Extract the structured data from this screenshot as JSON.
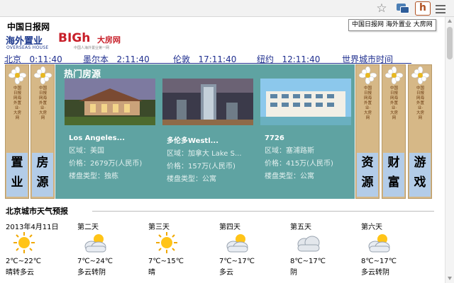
{
  "toolbar": {
    "star_icon": "star-icon",
    "ext_icon": "screens-extension-icon",
    "h_label": "h",
    "menu_icon": "menu-icon"
  },
  "tooltip": "中国日报网 海外置业 大房网",
  "logo": {
    "chinadaily": "中国日报网",
    "haiwai": "海外置业",
    "overseas_house": "OVERSEAS HOUSE",
    "bigh": "BIGh",
    "dafang": "大房网",
    "slogan": "中国人海外置业第一网"
  },
  "times": [
    {
      "city": "北京",
      "time": "0:11:40"
    },
    {
      "city": "墨尔本",
      "time": "2:11:40"
    },
    {
      "city": "伦敦",
      "time": "17:11:40"
    },
    {
      "city": "纽约",
      "time": "12:11:40"
    }
  ],
  "world_time_link": "世界城市时间",
  "banners": [
    {
      "vtext": "中国日报网海外置业·大房网",
      "big": "置业"
    },
    {
      "vtext": "中国日报网海外置业·大房网",
      "big": "房源"
    },
    {
      "vtext": "中国日报网海外置业·大房网",
      "big": "资源"
    },
    {
      "vtext": "中国日报网海外置业·大房网",
      "big": "财富"
    },
    {
      "vtext": "中国日报网海外置业·大房网",
      "big": "游戏"
    }
  ],
  "hot": {
    "title": "热门房源",
    "listings": [
      {
        "name": "Los Angeles...",
        "area": "区域：美国",
        "price": "价格：2679万(人民币)",
        "type": "楼盘类型：独栋"
      },
      {
        "name": "多伦多Westl...",
        "area": "区域：加拿大 Lake S...",
        "price": "价格：157万(人民币)",
        "type": "楼盘类型：公寓"
      },
      {
        "name": "7726",
        "area": "区域：塞浦路斯",
        "price": "价格：415万(人民币)",
        "type": "楼盘类型：公寓"
      }
    ]
  },
  "weather": {
    "title": "北京城市天气预报",
    "days": [
      {
        "label": "2013年4月11日",
        "icon": "sunny-icon",
        "temp": "2℃~22℃",
        "desc": "晴转多云"
      },
      {
        "label": "第二天",
        "icon": "partly-cloudy-icon",
        "temp": "7℃~24℃",
        "desc": "多云转阴"
      },
      {
        "label": "第三天",
        "icon": "sunny-icon",
        "temp": "7℃~15℃",
        "desc": "晴"
      },
      {
        "label": "第四天",
        "icon": "partly-cloudy-icon",
        "temp": "7℃~17℃",
        "desc": "多云"
      },
      {
        "label": "第五天",
        "icon": "cloudy-icon",
        "temp": "8℃~17℃",
        "desc": "阴"
      },
      {
        "label": "第六天",
        "icon": "partly-cloudy-icon",
        "temp": "8℃~17℃",
        "desc": "多云转阴"
      }
    ]
  },
  "colors": {
    "link_blue": "#1f2f8f",
    "hot_bg": "#5fa3a2",
    "banner_bg": "#d6b887",
    "banner_text_bg": "#b3cce8",
    "brand_red": "#c8202a"
  }
}
